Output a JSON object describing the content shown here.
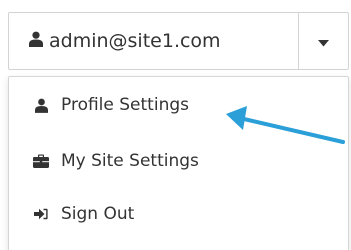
{
  "account_button": {
    "user_email": "admin@site1.com",
    "user_icon": "user-icon",
    "caret_icon": "caret-down-icon"
  },
  "menu": {
    "items": [
      {
        "label": "Profile Settings",
        "icon": "user-icon"
      },
      {
        "label": "My Site Settings",
        "icon": "briefcase-icon"
      },
      {
        "label": "Sign Out",
        "icon": "sign-out-icon"
      }
    ]
  },
  "colors": {
    "text": "#333333",
    "border": "#d3d3d3",
    "annotation_arrow": "#2b9fd8"
  }
}
